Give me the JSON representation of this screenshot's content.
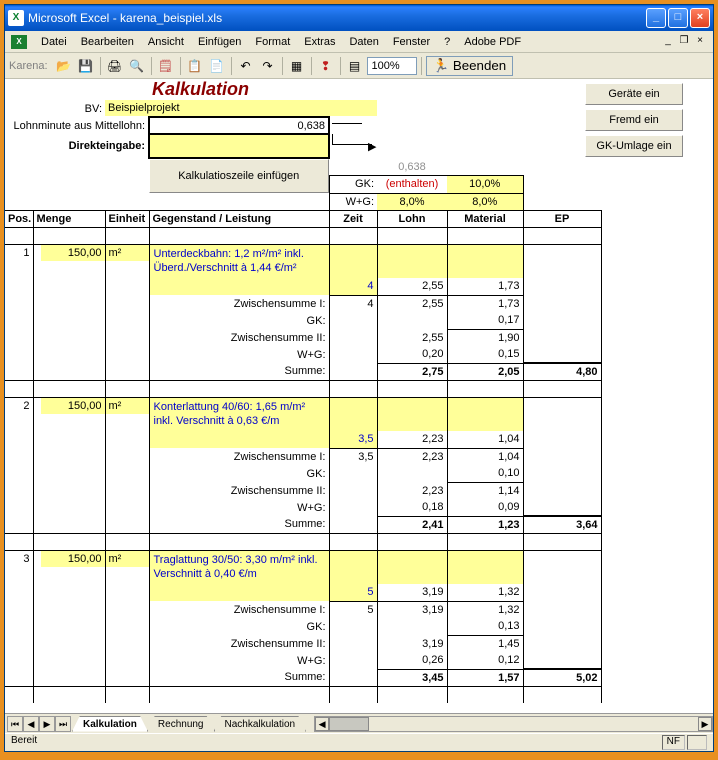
{
  "window": {
    "app": "Microsoft Excel",
    "file": "karena_beispiel.xls"
  },
  "menu": {
    "datei": "Datei",
    "bearbeiten": "Bearbeiten",
    "ansicht": "Ansicht",
    "einfuegen": "Einfügen",
    "format": "Format",
    "extras": "Extras",
    "daten": "Daten",
    "fenster": "Fenster",
    "help": "?",
    "adobe": "Adobe PDF"
  },
  "toolbar": {
    "label": "Karena:",
    "zoom": "100%",
    "beenden": "Beenden"
  },
  "side": {
    "geraete": "Geräte ein",
    "fremd": "Fremd ein",
    "gk": "GK-Umlage ein"
  },
  "header": {
    "title": "Kalkulation",
    "bv_label": "BV:",
    "bv_value": "Beispielprojekt",
    "lohn_label": "Lohnminute aus Mittellohn:",
    "lohn_value": "0,638",
    "direkt_label": "Direkteingabe:",
    "direkt_value": "",
    "insert_btn": "Kalkulatioszeile einfügen",
    "small_rate": "0,638",
    "gk_lbl": "GK:",
    "gk_val": "(enthalten)",
    "gk_pct": "10,0%",
    "wg_lbl": "W+G:",
    "wg_val": "8,0%",
    "wg_pct": "8,0%"
  },
  "cols": {
    "pos": "Pos.",
    "menge": "Menge",
    "einheit": "Einheit",
    "gegenstand": "Gegenstand / Leistung",
    "zeit": "Zeit",
    "lohn": "Lohn",
    "material": "Material",
    "ep": "EP"
  },
  "rlabels": {
    "zw1": "Zwischensumme I:",
    "gk": "GK:",
    "zw2": "Zwischensumme II:",
    "wg": "W+G:",
    "sum": "Summe:"
  },
  "positions": [
    {
      "pos": "1",
      "menge": "150,00",
      "einheit": "m²",
      "desc": "Unterdeckbahn: 1,2 m²/m² inkl. Überd./Verschnitt à 1,44 €/m²",
      "zeit": "4",
      "lohn": "2,55",
      "material": "1,73",
      "zw1": {
        "zeit": "4",
        "lohn": "2,55",
        "material": "1,73"
      },
      "gk": {
        "lohn": "",
        "material": "0,17"
      },
      "zw2": {
        "lohn": "2,55",
        "material": "1,90"
      },
      "wg": {
        "lohn": "0,20",
        "material": "0,15"
      },
      "sum": {
        "lohn": "2,75",
        "material": "2,05",
        "ep": "4,80"
      }
    },
    {
      "pos": "2",
      "menge": "150,00",
      "einheit": "m²",
      "desc": "Konterlattung 40/60: 1,65 m/m² inkl. Verschnitt à 0,63 €/m",
      "zeit": "3,5",
      "lohn": "2,23",
      "material": "1,04",
      "zw1": {
        "zeit": "3,5",
        "lohn": "2,23",
        "material": "1,04"
      },
      "gk": {
        "lohn": "",
        "material": "0,10"
      },
      "zw2": {
        "lohn": "2,23",
        "material": "1,14"
      },
      "wg": {
        "lohn": "0,18",
        "material": "0,09"
      },
      "sum": {
        "lohn": "2,41",
        "material": "1,23",
        "ep": "3,64"
      }
    },
    {
      "pos": "3",
      "menge": "150,00",
      "einheit": "m²",
      "desc": "Traglattung 30/50: 3,30 m/m² inkl. Verschnitt à 0,40 €/m",
      "zeit": "5",
      "lohn": "3,19",
      "material": "1,32",
      "zw1": {
        "zeit": "5",
        "lohn": "3,19",
        "material": "1,32"
      },
      "gk": {
        "lohn": "",
        "material": "0,13"
      },
      "zw2": {
        "lohn": "3,19",
        "material": "1,45"
      },
      "wg": {
        "lohn": "0,26",
        "material": "0,12"
      },
      "sum": {
        "lohn": "3,45",
        "material": "1,57",
        "ep": "5,02"
      }
    }
  ],
  "tabs": {
    "t1": "Kalkulation",
    "t2": "Rechnung",
    "t3": "Nachkalkulation"
  },
  "status": {
    "ready": "Bereit",
    "nf": "NF"
  }
}
